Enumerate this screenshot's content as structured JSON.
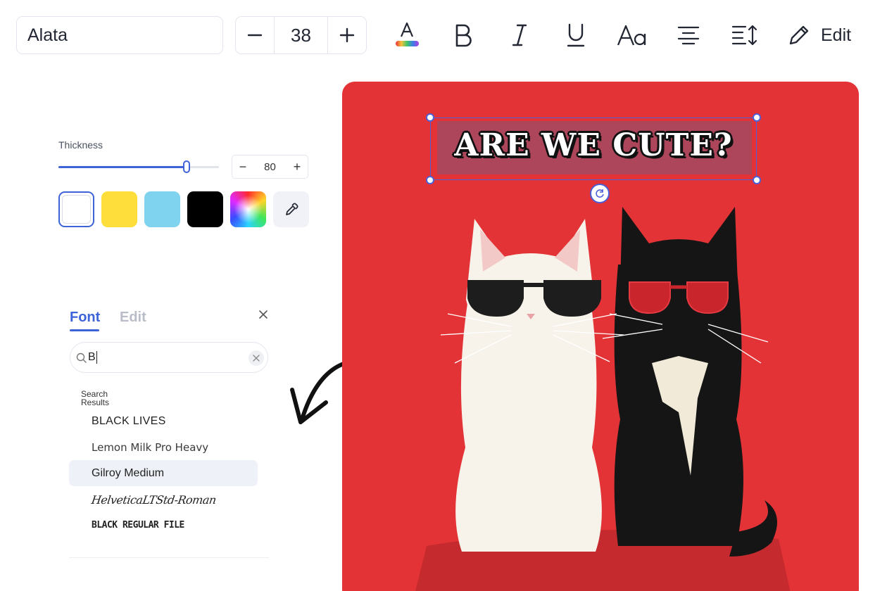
{
  "toolbar": {
    "font_name": "Alata",
    "font_size": "38",
    "edit_label": "Edit",
    "icons": [
      "minus-icon",
      "plus-icon",
      "text-color-icon",
      "bold-icon",
      "italic-icon",
      "underline-icon",
      "text-case-icon",
      "align-center-icon",
      "line-spacing-icon",
      "pencil-icon"
    ]
  },
  "thickness": {
    "label": "Thickness",
    "value": "80",
    "slider_fraction": 0.8,
    "accent_color": "#3e63d8",
    "swatches": [
      {
        "name": "white",
        "color": "#ffffff",
        "selected": true
      },
      {
        "name": "yellow",
        "color": "#fede3a"
      },
      {
        "name": "light-blue",
        "color": "#7fd3ee"
      },
      {
        "name": "black",
        "color": "#000000"
      },
      {
        "name": "rainbow",
        "color": "conic-gradient"
      }
    ]
  },
  "font_panel": {
    "tabs": [
      "Font",
      "Edit"
    ],
    "active_tab": "Font",
    "search_value": "B",
    "results_label": "Search Results",
    "results": [
      "BLACK LIVES",
      "Lemon Milk Pro Heavy",
      "Gilroy Medium",
      "HelveticaLTStd-Roman",
      "BLACK REGULAR FILE"
    ],
    "highlighted_result": "Gilroy Medium"
  },
  "canvas": {
    "headline": "ARE WE CUTE?",
    "background_color": "#e33336"
  }
}
